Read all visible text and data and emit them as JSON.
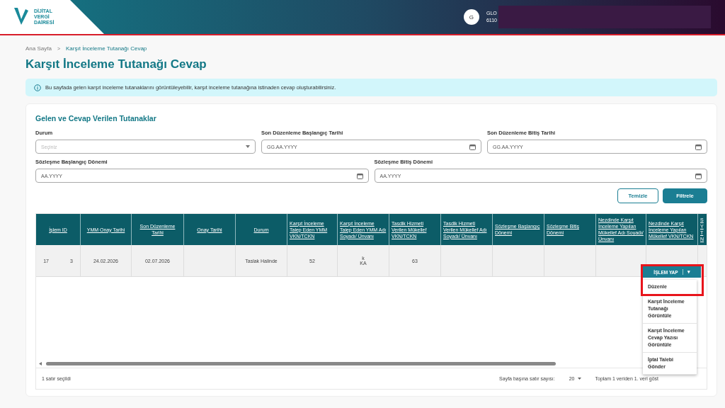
{
  "header": {
    "logo_lines": [
      "DİJİTAL",
      "VERGİ",
      "DAİRESİ"
    ],
    "avatar": "G",
    "user_name": "GLO",
    "user_id": "6110"
  },
  "breadcrumb": [
    {
      "label": "Ana Sayfa",
      "selected": false
    },
    {
      "label": "Karşıt İnceleme Tutanağı Cevap",
      "selected": true
    }
  ],
  "breadcrumb_separator": ">",
  "page_title": "Karşıt İnceleme Tutanağı Cevap",
  "info": "Bu sayfada gelen karşıt inceleme tutanaklarını görüntüleyebilir, karşıt inceleme tutanağına istinaden cevap oluşturabilirsiniz.",
  "card_title": "Gelen ve Cevap Verilen Tutanaklar",
  "filters": [
    {
      "label": "Durum",
      "placeholder": "Seçiniz",
      "kind": "select"
    },
    {
      "label": "Son Düzenleme Başlangıç Tarihi",
      "placeholder": "GG.AA.YYYY",
      "kind": "date"
    },
    {
      "label": "Son Düzenleme Bitiş Tarihi",
      "placeholder": "GG.AA.YYYY",
      "kind": "date"
    },
    {
      "label": "Sözleşme Başlangıç Dönemi",
      "placeholder": "AA.YYYY",
      "kind": "date"
    },
    {
      "label": "Sözleşme Bitiş Dönemi",
      "placeholder": "AA.YYYY",
      "kind": "date"
    }
  ],
  "buttons": [
    {
      "label": "Temizle",
      "kind": "outline"
    },
    {
      "label": "Filtrele",
      "kind": "primary"
    }
  ],
  "table": {
    "columns": [
      "İşlem ID",
      "YMM Onay Tarihi",
      "Son Düzenleme Tarihi",
      "Onay Tarihi",
      "Durum",
      "Karşıt İnceleme Talep Eden YMM VKN/TCKN",
      "Karşıt İnceleme Talep Eden YMM Adı Soyadı/ Ünvanı",
      "Tasdik Hizmeti Verilen Mükellef VKN/TCKN",
      "Tasdik Hizmeti Verilen Mükellef Adı Soyadı/ Ünvanı",
      "Sözleşme Başlangıç Dönemi",
      "Sözleşme Bitiş Dönemi",
      "Nezdinde Karşıt İnceleme Yapılan Mükellef Adı Soyadı/Ünvanı",
      "Nezdinde Karşıt İnceleme Yapılan Mükellef VKN/TCKN",
      "S Y T N"
    ],
    "rows": [
      {
        "selected": true,
        "cells": [
          [
            "17",
            "3"
          ],
          [
            "24.02.2026"
          ],
          [
            "02.07.2026"
          ],
          [],
          [
            "Taslak Halinde"
          ],
          [
            "52"
          ],
          [
            "k",
            "KA"
          ],
          [
            "63"
          ],
          [],
          [],
          [],
          [],
          []
        ]
      }
    ]
  },
  "action_button": {
    "label": "İŞLEM YAP",
    "caret": "▾"
  },
  "action_menu": [
    "Düzenle",
    "Karşıt İnceleme Tutanağı Görüntüle",
    "Karşıt İnceleme Cevap Yazısı Görüntüle",
    "İptal Talebi Gönder"
  ],
  "footer": {
    "selection": "1 satır seçildi",
    "rows_per_page_label": "Sayfa başına satır sayısı:",
    "rows_per_page": "20",
    "total": "Toplam 1 veriden 1. veri göst"
  }
}
